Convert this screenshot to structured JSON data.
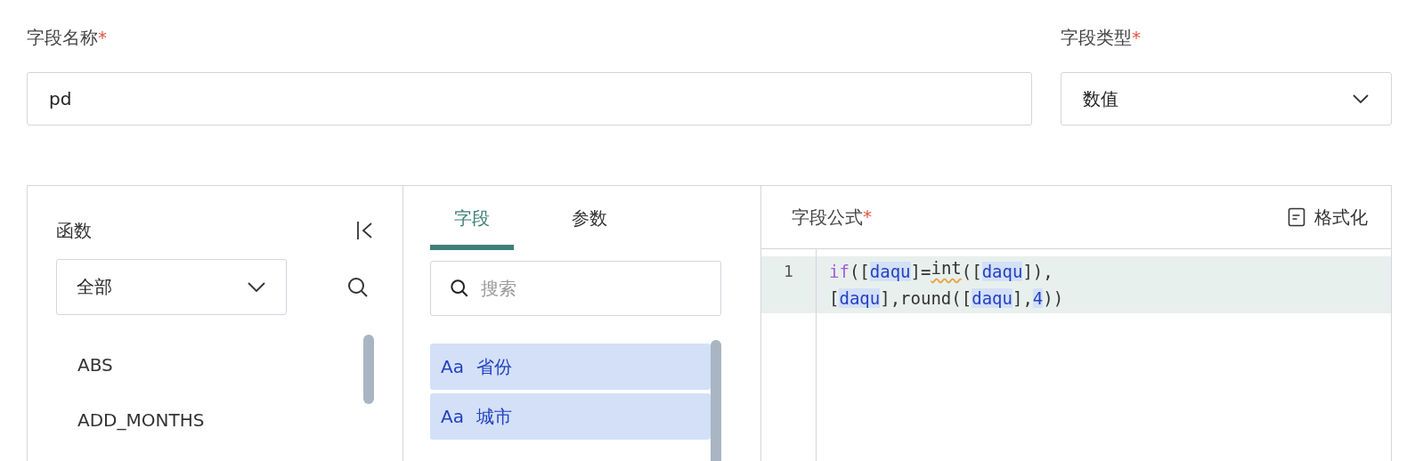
{
  "name_field": {
    "label": "字段名称",
    "required_mark": "*",
    "value": "pd"
  },
  "type_field": {
    "label": "字段类型",
    "required_mark": "*",
    "value": "数值"
  },
  "functions": {
    "title": "函数",
    "category": "全部",
    "items": [
      "ABS",
      "ADD_MONTHS"
    ]
  },
  "tabs": [
    {
      "label": "字段",
      "selected": true
    },
    {
      "label": "参数",
      "selected": false
    }
  ],
  "field_search": {
    "placeholder": "搜索"
  },
  "fields": [
    {
      "type_mark": "Aa",
      "name": "省份"
    },
    {
      "type_mark": "Aa",
      "name": "城市"
    }
  ],
  "formula": {
    "title": "字段公式",
    "required_mark": "*",
    "format_button": "格式化",
    "line_number": "1",
    "tokens": [
      {
        "kind": "keyword",
        "text": "if"
      },
      {
        "kind": "punct",
        "text": "(["
      },
      {
        "kind": "field",
        "text": "daqu"
      },
      {
        "kind": "punct",
        "text": "]="
      },
      {
        "kind": "func",
        "text": "int",
        "warning": true
      },
      {
        "kind": "punct",
        "text": "(["
      },
      {
        "kind": "field",
        "text": "daqu"
      },
      {
        "kind": "punct",
        "text": "]),"
      },
      {
        "kind": "break"
      },
      {
        "kind": "punct",
        "text": "["
      },
      {
        "kind": "field",
        "text": "daqu"
      },
      {
        "kind": "punct",
        "text": "],"
      },
      {
        "kind": "func",
        "text": "round",
        "warning": false
      },
      {
        "kind": "punct",
        "text": "(["
      },
      {
        "kind": "field",
        "text": "daqu"
      },
      {
        "kind": "punct",
        "text": "],"
      },
      {
        "kind": "number",
        "text": "4"
      },
      {
        "kind": "punct",
        "text": "))"
      }
    ]
  }
}
